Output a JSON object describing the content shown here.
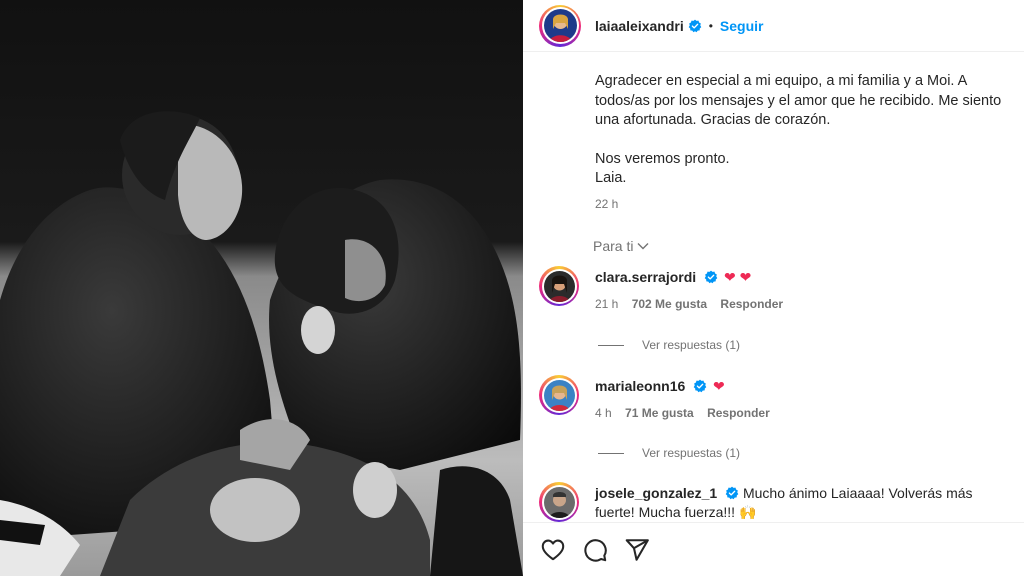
{
  "header": {
    "username": "laiaaleixandri",
    "separator": "•",
    "follow_label": "Seguir"
  },
  "caption": {
    "paragraph_1": "Agradecer en especial a mi equipo, a mi familia y a Moi. A todos/as por los mensajes y el amor que he recibido. Me siento una afortunada. Gracias de corazón.",
    "line_2": "Nos veremos pronto.",
    "line_3": "Laia.",
    "time": "22 h"
  },
  "sort": {
    "label": "Para ti"
  },
  "comments": [
    {
      "username": "clara.serrajordi",
      "text": "",
      "hearts": "❤ ❤",
      "time": "21 h",
      "likes": "702 Me gusta",
      "reply_label": "Responder",
      "view_replies": "Ver respuestas (1)"
    },
    {
      "username": "marialeonn16",
      "text": "",
      "hearts": "❤",
      "time": "4 h",
      "likes": "71 Me gusta",
      "reply_label": "Responder",
      "view_replies": "Ver respuestas (1)"
    },
    {
      "username": "josele_gonzalez_1",
      "text": "Mucho ánimo Laiaaaa! Volverás más fuerte! Mucha fuerza!!! 🙌"
    }
  ],
  "icons": [
    "heart-icon",
    "comment-icon",
    "share-icon",
    "verified-icon",
    "chevron-down-icon"
  ],
  "colors": {
    "link": "#0095f6",
    "verified": "#0095f6",
    "heart": "#ee2a55",
    "muted": "#737373"
  }
}
